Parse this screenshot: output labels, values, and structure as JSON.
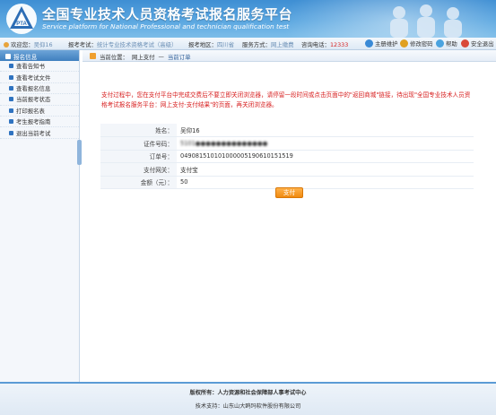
{
  "header": {
    "title": "全国专业技术人员资格考试报名服务平台",
    "subtitle": "Service platform for National Professional and technician qualification test"
  },
  "infobar": {
    "welcome_label": "欢迎您：",
    "user_name": "吴仰16",
    "exam_label": "报考考试：",
    "exam_value": "统计专业技术资格考试（高级）",
    "region_label": "报考地区：",
    "region_value": "四川省",
    "service_label": "服务方式：",
    "service_value": "网上缴费",
    "phone_label": "咨询电话：",
    "phone_value": "12333",
    "controls": {
      "maintain": "主册维护",
      "change_password": "修改密码",
      "help": "帮助",
      "logout": "安全退出"
    }
  },
  "sidebar": {
    "title": "报名信息",
    "items": [
      "查看告知书",
      "查看考试文件",
      "查看报名信息",
      "当前报考状态",
      "打印报名表",
      "考生报考指南",
      "退出当前考试"
    ]
  },
  "breadcrumb": {
    "label": "当前位置：",
    "section": "网上支付",
    "separator": "—",
    "current": "当前订单"
  },
  "notice": "支付过程中，您在支付平台中完成交费后不要立即关闭浏览器，请停留一段时间或点击页面中的\"返回商城\"链接，待出现\"全国专业技术人员资格考试报名服务平台：网上支付-支付结果\"的页面，再关闭浏览器。",
  "order": {
    "rows": [
      {
        "label": "姓名：",
        "value": "吴仰16",
        "blurred": false
      },
      {
        "label": "证件号码：",
        "value": "5101●●●●●●●●●●●●●●",
        "blurred": true
      },
      {
        "label": "订单号：",
        "value": "04908151010100000519061015151​9",
        "blurred": false
      },
      {
        "label": "支付网关：",
        "value": "支付宝",
        "blurred": false
      },
      {
        "label": "金额（元）：",
        "value": "50",
        "blurred": false
      }
    ],
    "pay_button": "支付"
  },
  "footer": {
    "copyright": "版权所有：人力资源和社会保障部人事考试中心",
    "tech_support": "技术支持：山东山大鸥玛软件股份有限公司"
  }
}
